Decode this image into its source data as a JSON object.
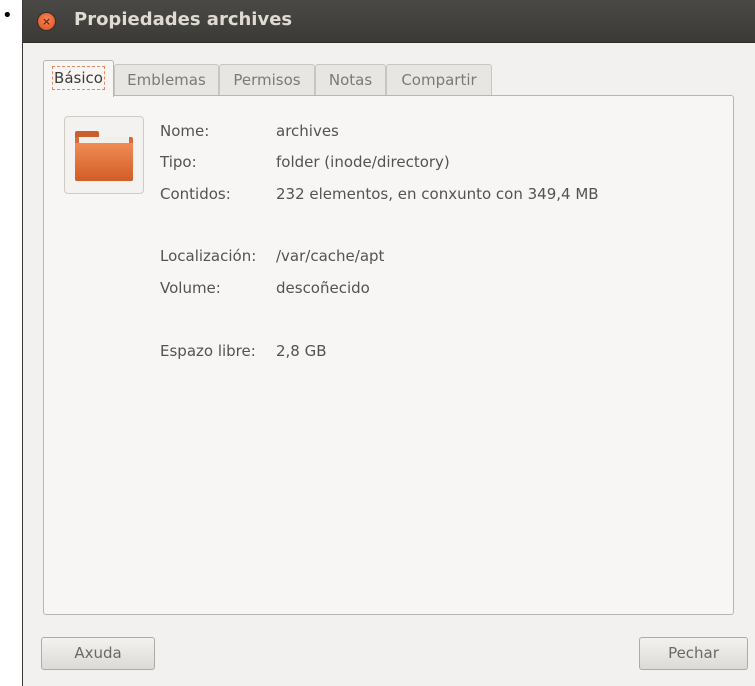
{
  "bullet": "•",
  "window": {
    "title": "Propiedades archives",
    "close_glyph": "×"
  },
  "tabs": [
    {
      "label": "Básico",
      "active": true
    },
    {
      "label": "Emblemas",
      "active": false
    },
    {
      "label": "Permisos",
      "active": false
    },
    {
      "label": "Notas",
      "active": false
    },
    {
      "label": "Compartir",
      "active": false
    }
  ],
  "icon": "folder-icon",
  "properties": {
    "name": {
      "label": "Nome:",
      "value": "archives"
    },
    "type": {
      "label": "Tipo:",
      "value": "folder (inode/directory)"
    },
    "contents": {
      "label": "Contidos:",
      "value": "232 elementos, en conxunto con 349,4 MB"
    },
    "location": {
      "label": "Localización:",
      "value": "/var/cache/apt"
    },
    "volume": {
      "label": "Volume:",
      "value": "descoñecido"
    },
    "free_space": {
      "label": "Espazo libre:",
      "value": "2,8 GB"
    }
  },
  "buttons": {
    "help": "Axuda",
    "close": "Pechar"
  }
}
